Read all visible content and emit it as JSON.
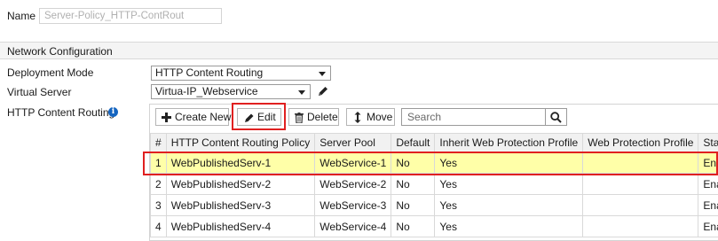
{
  "name": {
    "label": "Name",
    "value": "Server-Policy_HTTP-ContRout"
  },
  "section": {
    "title": "Network Configuration"
  },
  "deployment_mode": {
    "label": "Deployment Mode",
    "value": "HTTP Content Routing"
  },
  "virtual_server": {
    "label": "Virtual Server",
    "value": "Virtua-IP_Webservice"
  },
  "http_content_routing": {
    "label": "HTTP Content Routing"
  },
  "toolbar": {
    "create_new": "Create New",
    "edit": "Edit",
    "delete": "Delete",
    "move": "Move",
    "search_placeholder": "Search"
  },
  "table": {
    "headers": [
      "#",
      "HTTP Content Routing Policy",
      "Server Pool",
      "Default",
      "Inherit Web Protection Profile",
      "Web Protection Profile",
      "Status"
    ],
    "rows": [
      {
        "num": "1",
        "policy": "WebPublishedServ-1",
        "pool": "WebService-1",
        "default": "No",
        "inherit": "Yes",
        "profile": "",
        "status": "Enabled"
      },
      {
        "num": "2",
        "policy": "WebPublishedServ-2",
        "pool": "WebService-2",
        "default": "No",
        "inherit": "Yes",
        "profile": "",
        "status": "Enabled"
      },
      {
        "num": "3",
        "policy": "WebPublishedServ-3",
        "pool": "WebService-3",
        "default": "No",
        "inherit": "Yes",
        "profile": "",
        "status": "Enabled"
      },
      {
        "num": "4",
        "policy": "WebPublishedServ-4",
        "pool": "WebService-4",
        "default": "No",
        "inherit": "Yes",
        "profile": "",
        "status": "Enabled"
      }
    ]
  },
  "colors": {
    "highlight_red": "#e02020",
    "selected_row": "#ffffa8",
    "info_blue": "#1565c0"
  }
}
